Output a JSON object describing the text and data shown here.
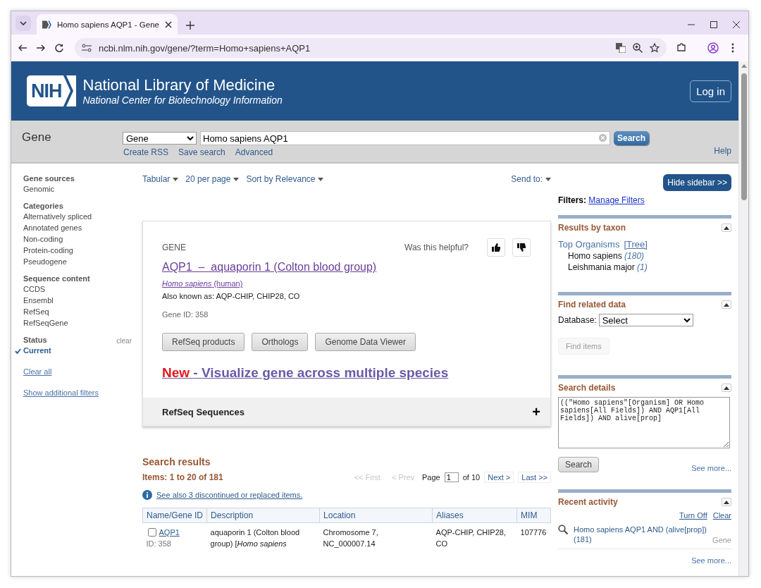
{
  "browser": {
    "tab_title": "Homo sapiens AQP1 - Gene",
    "url": "ncbi.nlm.nih.gov/gene/?term=Homo+sapiens+AQP1"
  },
  "header": {
    "logo": "NIH",
    "title": "National Library of Medicine",
    "subtitle": "National Center for Biotechnology Information",
    "login": "Log in"
  },
  "search_bar": {
    "database_label": "Gene",
    "database": "Gene",
    "query": "Homo sapiens AQP1",
    "button": "Search",
    "links": [
      "Create RSS",
      "Save search",
      "Advanced"
    ],
    "help": "Help"
  },
  "filters": [
    {
      "title": "Gene sources",
      "items": [
        {
          "label": "Genomic",
          "selected": false
        }
      ]
    },
    {
      "title": "Categories",
      "items": [
        {
          "label": "Alternatively spliced",
          "selected": false
        },
        {
          "label": "Annotated genes",
          "selected": false
        },
        {
          "label": "Non-coding",
          "selected": false
        },
        {
          "label": "Protein-coding",
          "selected": false
        },
        {
          "label": "Pseudogene",
          "selected": false
        }
      ]
    },
    {
      "title": "Sequence content",
      "items": [
        {
          "label": "CCDS",
          "selected": false
        },
        {
          "label": "Ensembl",
          "selected": false
        },
        {
          "label": "RefSeq",
          "selected": false
        },
        {
          "label": "RefSeqGene",
          "selected": false
        }
      ]
    },
    {
      "title": "Status",
      "clear": "clear",
      "items": [
        {
          "label": "Current",
          "selected": true
        }
      ]
    }
  ],
  "filter_links": [
    "Clear all",
    "Show additional filters"
  ],
  "display_options": [
    "Tabular",
    "20 per page",
    "Sort by Relevance"
  ],
  "send_to": "Send to:",
  "gene_card": {
    "kind_label": "GENE",
    "helpful": "Was this helpful?",
    "title": "AQP1  –  aquaporin 1 (Colton blood group)",
    "organism": "Homo sapiens",
    "organism_common": "(human)",
    "aliases": "Also known as: AQP-CHIP, CHIP28, CO",
    "gene_id": "Gene ID: 358",
    "buttons": [
      "RefSeq products",
      "Orthologs",
      "Genome Data Viewer"
    ],
    "new_label": "New",
    "new_link": "- Visualize gene across multiple species",
    "section": {
      "title": "RefSeq Sequences",
      "expanded": false,
      "toggle": "+"
    }
  },
  "results": {
    "title": "Search results",
    "count": "Items: 1 to 20 of 181",
    "pager_before": [
      {
        "label": "<< First",
        "disabled": true
      },
      {
        "label": "< Prev",
        "disabled": true
      }
    ],
    "page_label": "Page",
    "page": "1",
    "page_total": "of 10",
    "pager_after": [
      {
        "label": "Next >",
        "disabled": false
      },
      {
        "label": "Last >>",
        "disabled": false
      }
    ],
    "notice": "See also 3 discontinued or replaced items.",
    "table": {
      "columns": [
        "Name/Gene ID",
        "Description",
        "Location",
        "Aliases",
        "MIM"
      ],
      "rows": [
        {
          "checked": false,
          "name": "AQP1",
          "id": "ID: 358",
          "description": "aquaporin 1 (Colton blood group) [*Homo sapiens*",
          "location": "Chromosome 7, NC_000007.14",
          "aliases": "AQP-CHIP, CHIP28, CO",
          "mim": "107776"
        }
      ]
    }
  },
  "sidebar": {
    "hide_button": "Hide sidebar >>",
    "filters_label": "Filters:",
    "manage_filters": "Manage Filters",
    "taxon": {
      "title": "Results by taxon",
      "top": "Top Organisms",
      "tree": "[Tree]",
      "organisms": [
        {
          "name": "Homo sapiens",
          "count": "(180)"
        },
        {
          "name": "Leishmania major",
          "count": "(1)"
        }
      ]
    },
    "related": {
      "title": "Find related data",
      "database_label": "Database:",
      "database": "Select",
      "button": {
        "label": "Find items",
        "disabled": true
      }
    },
    "details": {
      "title": "Search details",
      "query": "((\"Homo sapiens\"[Organism] OR Homo sapiens[All Fields]) AND AQP1[All Fields]) AND alive[prop]",
      "button": "Search",
      "see_more": "See more..."
    },
    "activity": {
      "title": "Recent activity",
      "links": [
        "Turn Off",
        "Clear"
      ],
      "items": [
        {
          "query": "Homo sapiens AQP1 AND (alive[prop]) (181)",
          "database": "Gene"
        }
      ],
      "see_more": "See more..."
    }
  }
}
